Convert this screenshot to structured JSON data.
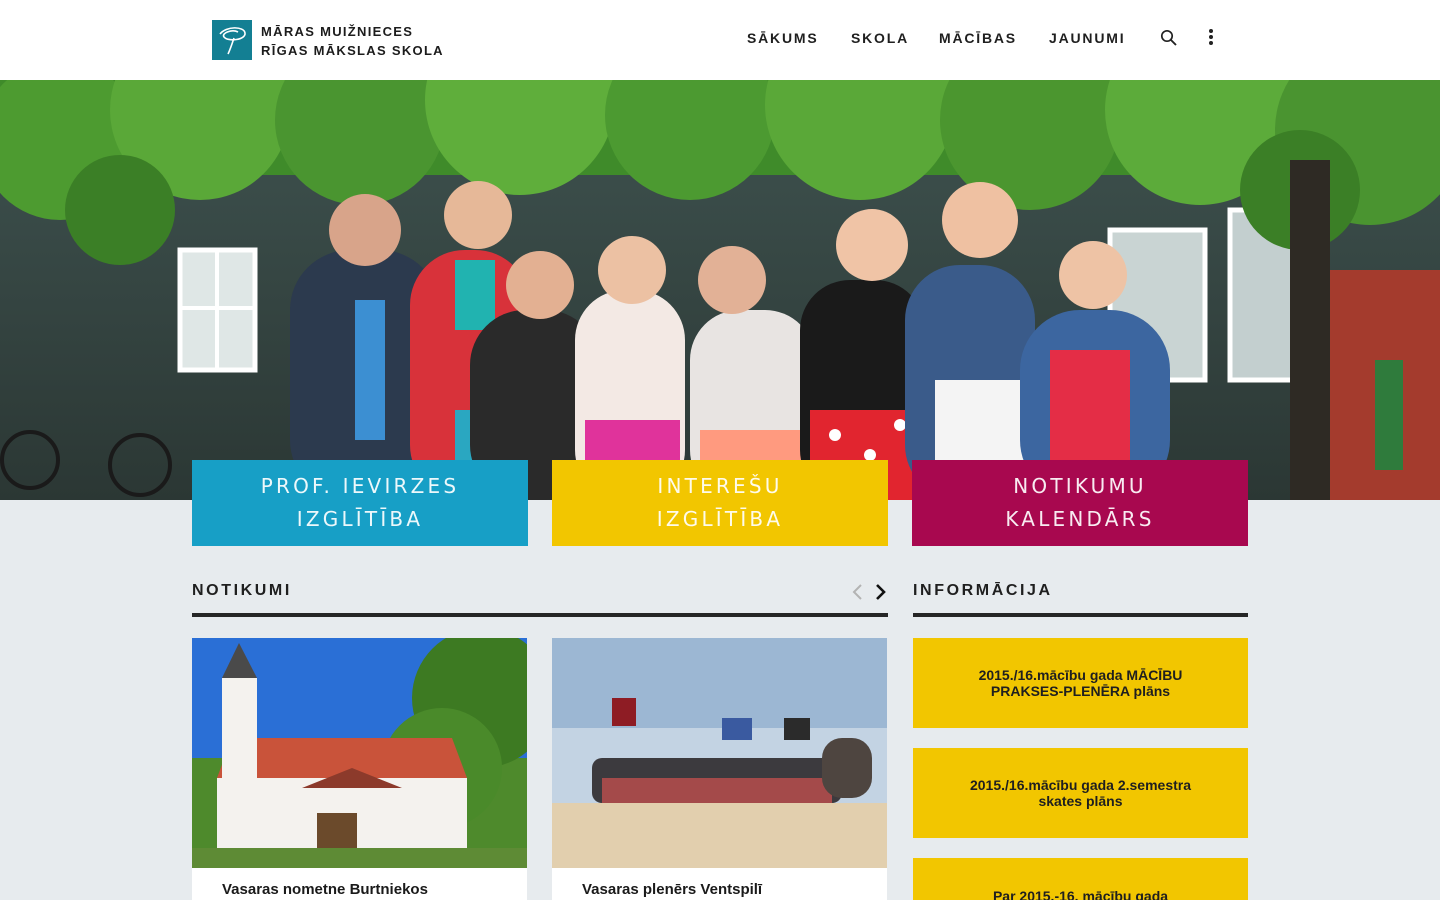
{
  "header": {
    "logo_line1": "MĀRAS MUIŽNIECES",
    "logo_line2": "RĪGAS MĀKSLAS SKOLA",
    "nav": [
      "SĀKUMS",
      "SKOLA",
      "MĀCĪBAS",
      "JAUNUMI"
    ],
    "icons": [
      "search-icon",
      "more-vertical-icon"
    ]
  },
  "tiles": [
    {
      "label": "PROF. IEVIRZES\nIZGLĪTĪBA",
      "color": "#179fc6"
    },
    {
      "label": "INTEREŠU\nIZGLĪTĪBA",
      "color": "#f2c600"
    },
    {
      "label": "NOTIKUMU\nKALENDĀRS",
      "color": "#a8084f"
    }
  ],
  "events": {
    "title": "NOTIKUMI",
    "prev_icon": "chevron-left-icon",
    "next_icon": "chevron-right-icon",
    "cards": [
      {
        "title": "Vasaras nometne Burtniekos"
      },
      {
        "title": "Vasaras plenērs Ventspilī"
      }
    ]
  },
  "info": {
    "title": "INFORMĀCIJA",
    "items": [
      "2015./16.mācību gada MĀCĪBU PRAKSES-PLENĒRA plāns",
      "2015./16.mācību gada 2.semestra skates plāns",
      "Par 2015.-16. mācību gada"
    ],
    "color": "#f2c600"
  }
}
